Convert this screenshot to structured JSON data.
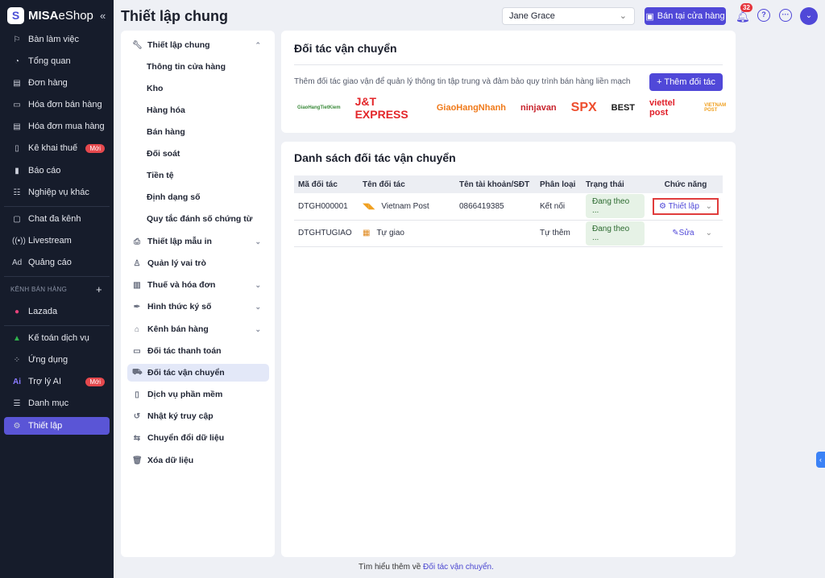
{
  "brand": {
    "name_bold": "MISA",
    "name_light": "eShop"
  },
  "sidebar": {
    "items": [
      {
        "label": "Bàn làm việc",
        "icon": "desk-icon"
      },
      {
        "label": "Tổng quan",
        "icon": "dashboard-icon"
      },
      {
        "label": "Đơn hàng",
        "icon": "order-icon"
      },
      {
        "label": "Hóa đơn bán hàng",
        "icon": "invoice-icon"
      },
      {
        "label": "Hóa đơn mua hàng",
        "icon": "purchase-invoice-icon"
      },
      {
        "label": "Kê khai thuế",
        "icon": "tax-icon",
        "badge": "Mới"
      },
      {
        "label": "Báo cáo",
        "icon": "report-icon"
      },
      {
        "label": "Nghiệp vụ khác",
        "icon": "list-icon"
      },
      {
        "label": "Chat đa kênh",
        "icon": "chat-icon"
      },
      {
        "label": "Livestream",
        "icon": "livestream-icon"
      },
      {
        "label": "Quảng cáo",
        "icon": "ads-icon"
      },
      {
        "label": "Lazada",
        "icon": "lazada-icon"
      },
      {
        "label": "Kế toán dịch vụ",
        "icon": "accounting-icon"
      },
      {
        "label": "Ứng dụng",
        "icon": "apps-icon"
      },
      {
        "label": "Trợ lý AI",
        "icon": "ai-icon",
        "badge": "Mới"
      },
      {
        "label": "Danh mục",
        "icon": "catalog-icon"
      },
      {
        "label": "Thiết lập",
        "icon": "gear-icon",
        "active": true
      }
    ],
    "section": "KÊNH BÁN HÀNG"
  },
  "header": {
    "title": "Thiết lập chung",
    "user": "Jane Grace",
    "store_button": "Bán tại cửa hàng",
    "notif_count": "32"
  },
  "settings": {
    "items": [
      {
        "label": "Thiết lập chung"
      },
      {
        "label": "Thông tin cửa hàng"
      },
      {
        "label": "Kho"
      },
      {
        "label": "Hàng hóa"
      },
      {
        "label": "Bán hàng"
      },
      {
        "label": "Đối soát"
      },
      {
        "label": "Tiền tệ"
      },
      {
        "label": "Định dạng số"
      },
      {
        "label": "Quy tắc đánh số chứng từ"
      },
      {
        "label": "Thiết lập mẫu in"
      },
      {
        "label": "Quản lý vai trò"
      },
      {
        "label": "Thuế và hóa đơn"
      },
      {
        "label": "Hình thức ký số"
      },
      {
        "label": "Kênh bán hàng"
      },
      {
        "label": "Đối tác thanh toán"
      },
      {
        "label": "Đối tác vận chuyển"
      },
      {
        "label": "Dịch vụ phần mềm"
      },
      {
        "label": "Nhật ký truy cập"
      },
      {
        "label": "Chuyển đổi dữ liệu"
      },
      {
        "label": "Xóa dữ liệu"
      }
    ]
  },
  "partners": {
    "title": "Đối tác vận chuyển",
    "desc": "Thêm đối tác giao vận để quản lý thông tin tập trung và đảm bảo quy trình bán hàng liền mạch",
    "add_label": "+ Thêm đối tác",
    "logos": [
      "GiaoHangTietKiem",
      "J&T EXPRESS",
      "GiaoHangNhanh",
      "ninjavan",
      "SPX",
      "BEST",
      "viettel post",
      "VIETNAM POST"
    ]
  },
  "list": {
    "title": "Danh sách đối tác vận chuyển",
    "columns": [
      "Mã đối tác",
      "Tên đối tác",
      "Tên tài khoản/SĐT",
      "Phân loại",
      "Trạng thái",
      "Chức năng"
    ],
    "rows": [
      {
        "code": "DTGH000001",
        "name": "Vietnam Post",
        "account": "0866419385",
        "type": "Kết nối",
        "status": "Đang theo ...",
        "action": "Thiết lập"
      },
      {
        "code": "DTGHTUGIAO",
        "name": "Tự giao",
        "account": "",
        "type": "Tự thêm",
        "status": "Đang theo ...",
        "action": "Sửa"
      }
    ]
  },
  "footer": {
    "text": "Tìm hiểu thêm về ",
    "link": "Đối tác vận chuyển."
  }
}
